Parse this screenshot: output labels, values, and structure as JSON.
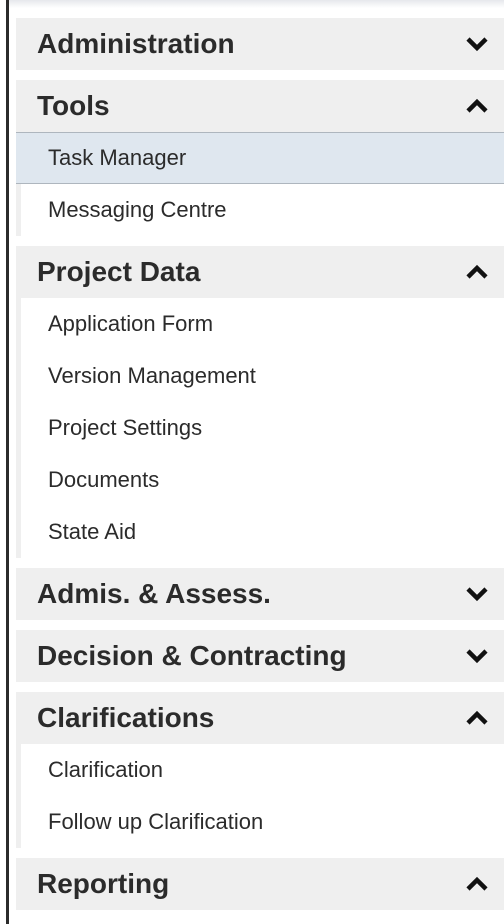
{
  "nav": {
    "sections": [
      {
        "title": "Administration",
        "state": "collapsed",
        "icon": "chevron-down-icon",
        "items": []
      },
      {
        "title": "Tools",
        "state": "expanded",
        "icon": "chevron-up-icon",
        "items": [
          {
            "label": "Task Manager",
            "active": true
          },
          {
            "label": "Messaging Centre",
            "active": false
          }
        ]
      },
      {
        "title": "Project Data",
        "state": "expanded",
        "icon": "chevron-up-icon",
        "items": [
          {
            "label": "Application Form",
            "active": false
          },
          {
            "label": "Version Management",
            "active": false
          },
          {
            "label": "Project Settings",
            "active": false
          },
          {
            "label": "Documents",
            "active": false
          },
          {
            "label": "State Aid",
            "active": false
          }
        ]
      },
      {
        "title": "Admis. & Assess.",
        "state": "collapsed",
        "icon": "chevron-down-icon",
        "items": []
      },
      {
        "title": "Decision & Contracting",
        "state": "collapsed",
        "icon": "chevron-down-icon",
        "items": []
      },
      {
        "title": "Clarifications",
        "state": "expanded",
        "icon": "chevron-up-icon",
        "items": [
          {
            "label": "Clarification",
            "active": false
          },
          {
            "label": "Follow up Clarification",
            "active": false
          }
        ]
      },
      {
        "title": "Reporting",
        "state": "expanded",
        "icon": "chevron-up-icon",
        "items": []
      }
    ]
  },
  "colors": {
    "header_bg": "#efefef",
    "active_bg": "#dfe7ef",
    "text": "#2b2b2b"
  }
}
